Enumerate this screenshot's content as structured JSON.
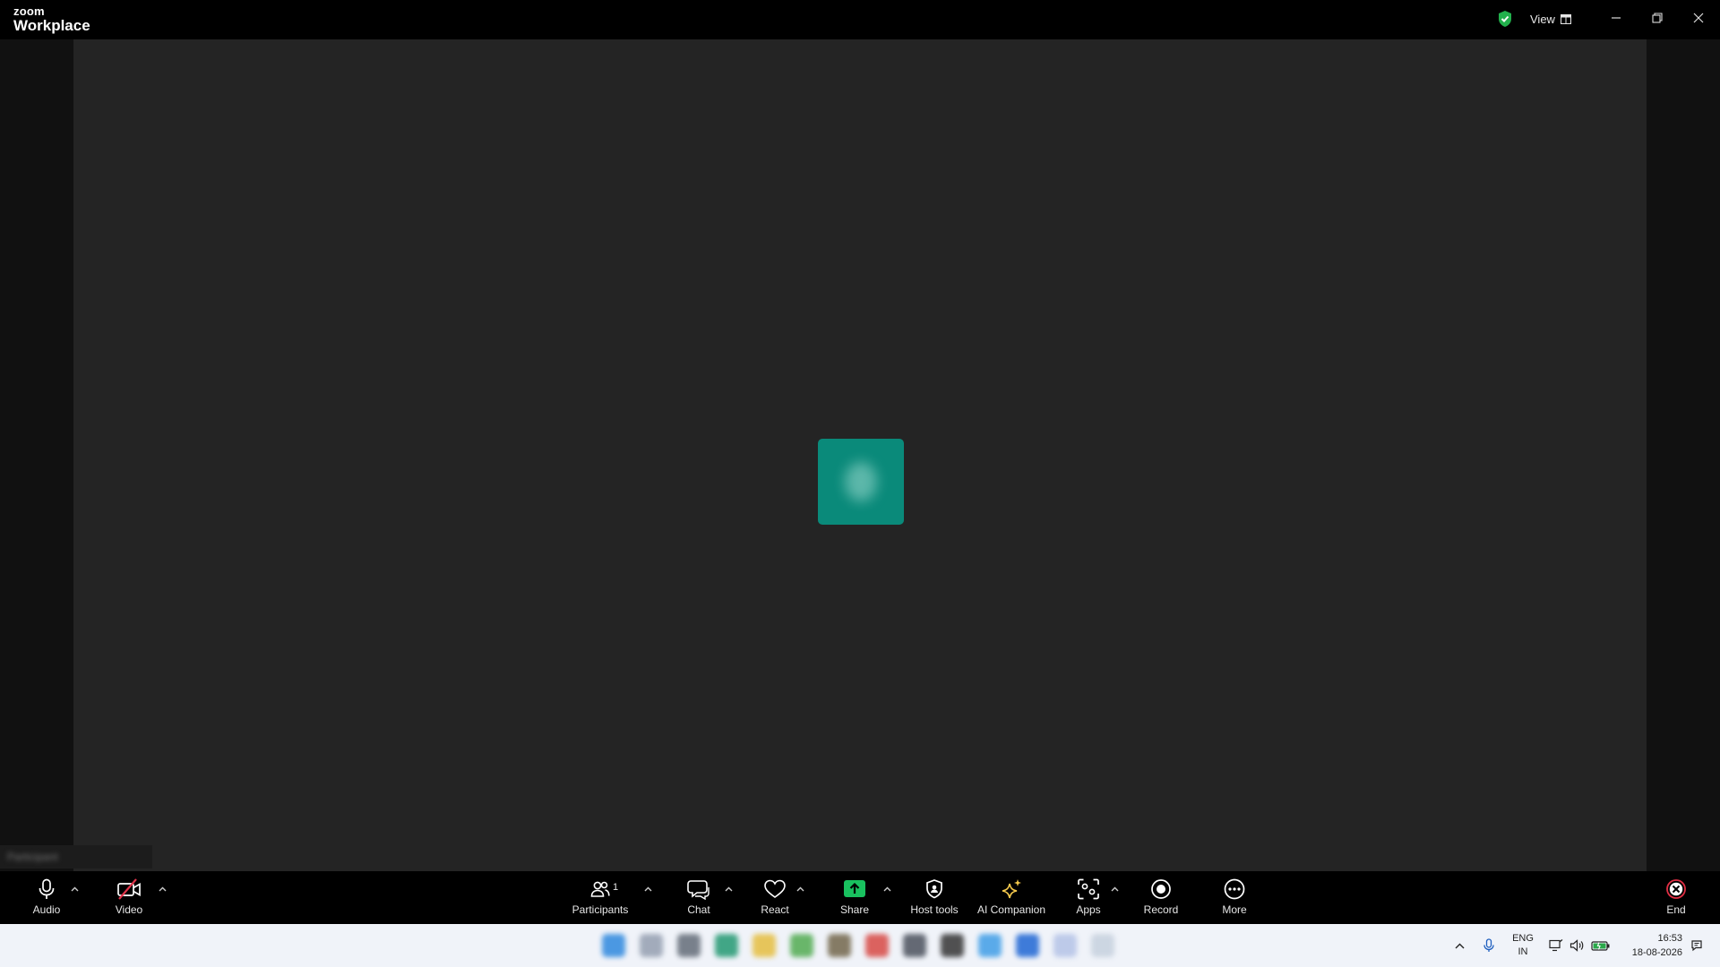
{
  "window": {
    "brand_small": "zoom",
    "brand_large": "Workplace",
    "view_label": "View"
  },
  "stage": {
    "avatar_color": "#0a8a7a",
    "participant_name": "Participant"
  },
  "toolbar": {
    "audio": "Audio",
    "video": "Video",
    "participants": "Participants",
    "participants_count": "1",
    "chat": "Chat",
    "react": "React",
    "share": "Share",
    "host_tools": "Host tools",
    "ai_companion": "AI Companion",
    "apps": "Apps",
    "record": "Record",
    "more": "More",
    "end": "End",
    "share_color": "#19c15f",
    "end_color": "#e02f44",
    "ai_color": "#f5c94c"
  },
  "taskbar": {
    "language": "ENG",
    "region": "IN",
    "time": "16:53",
    "date": "18-08-2026"
  }
}
